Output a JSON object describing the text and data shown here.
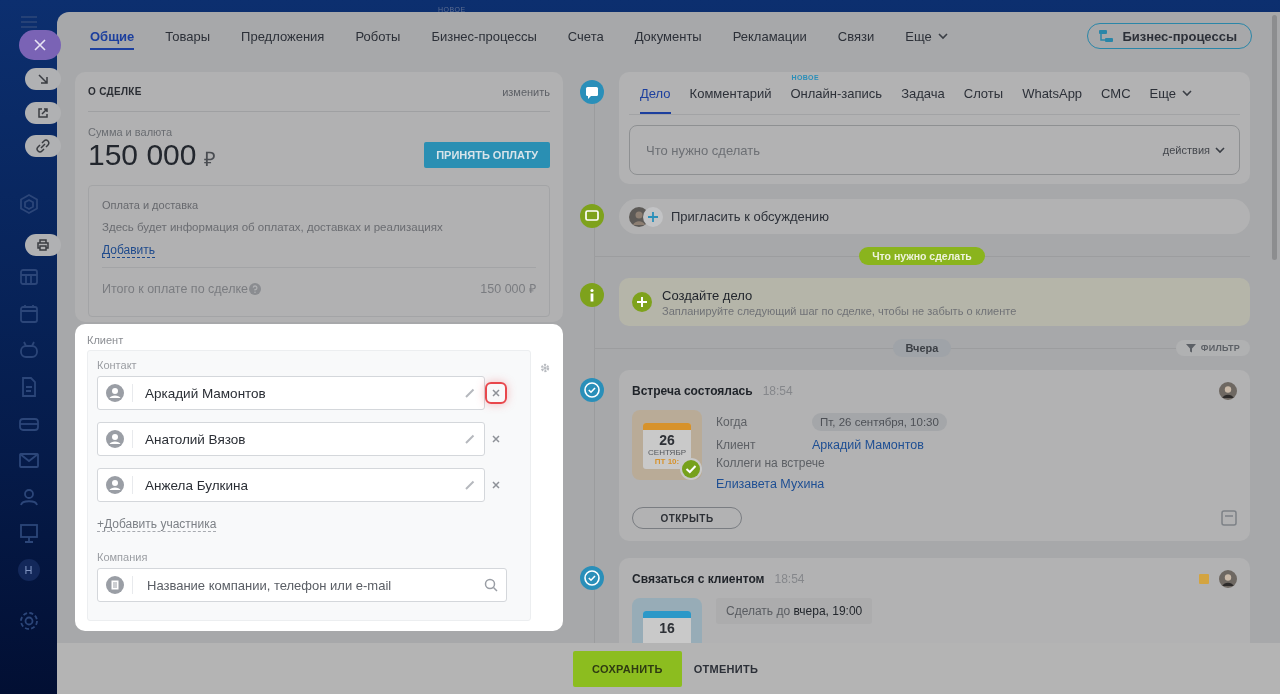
{
  "top_badge": "НОВОЕ",
  "sidebar_avatar": "Н",
  "tabs": [
    {
      "label": "Общие",
      "selected": true
    },
    {
      "label": "Товары",
      "selected": false
    },
    {
      "label": "Предложения",
      "selected": false
    },
    {
      "label": "Роботы",
      "selected": false
    },
    {
      "label": "Бизнес-процессы",
      "selected": false
    },
    {
      "label": "Счета",
      "selected": false
    },
    {
      "label": "Документы",
      "selected": false
    },
    {
      "label": "Рекламации",
      "selected": false
    },
    {
      "label": "Связи",
      "selected": false
    },
    {
      "label": "Еще",
      "selected": false,
      "kind": "more"
    }
  ],
  "bp_button": "Бизнес-процессы",
  "deal": {
    "title": "О СДЕЛКЕ",
    "edit": "изменить",
    "amount_label": "Сумма и валюта",
    "amount": "150 000",
    "currency": "₽",
    "pay_button": "ПРИНЯТЬ ОПЛАТУ",
    "payment": {
      "title": "Оплата и доставка",
      "text": "Здесь будет информация об оплатах, доставках и реализациях",
      "add": "Добавить",
      "total_label": "Итого к оплате по сделке",
      "total": "150 000 ₽"
    }
  },
  "client": {
    "label": "Клиент",
    "contact_label": "Контакт",
    "contacts": [
      {
        "name": "Аркадий Мамонтов",
        "highlighted": true
      },
      {
        "name": "Анатолий Вязов",
        "highlighted": false
      },
      {
        "name": "Анжела Булкина",
        "highlighted": false
      }
    ],
    "add": "+Добавить участника",
    "company_label": "Компания",
    "company_placeholder": "Название компании, телефон или e-mail"
  },
  "activity": {
    "tabs": [
      {
        "label": "Дело",
        "selected": true
      },
      {
        "label": "Комментарий",
        "selected": false
      },
      {
        "label": "Онлайн-запись",
        "selected": false,
        "badge": "НОВОЕ"
      },
      {
        "label": "Задача",
        "selected": false
      },
      {
        "label": "Слоты",
        "selected": false
      },
      {
        "label": "WhatsApp",
        "selected": false
      },
      {
        "label": "СМС",
        "selected": false
      },
      {
        "label": "Еще",
        "selected": false,
        "kind": "more"
      }
    ],
    "placeholder": "Что нужно сделать",
    "actions": "действия"
  },
  "invite": "Пригласить к обсуждению",
  "todo_divider": "Что нужно сделать",
  "create": {
    "title": "Создайте дело",
    "text": "Запланируйте следующий шаг по сделке, чтобы не забыть о клиенте"
  },
  "day_divider": "Вчера",
  "filter": "ФИЛЬТР",
  "events": [
    {
      "kind": "meeting",
      "title": "Встреча состоялась",
      "time": "18:54",
      "calendar": {
        "day": "26",
        "month": "СЕНТЯБР",
        "weekday": "ПТ 10:",
        "color": "#d7922a"
      },
      "fields": [
        {
          "label": "Когда",
          "value": "Пт, 26 сентября, 10:30",
          "kind": "pill"
        },
        {
          "label": "Клиент",
          "value": "Аркадий Мамонтов",
          "kind": "link"
        },
        {
          "label": "Коллеги на встрече",
          "value": "Елизавета Мухина",
          "kind": "link_below"
        }
      ],
      "open": "ОТКРЫТЬ"
    },
    {
      "kind": "call",
      "title": "Связаться с клиентом",
      "time": "18:54",
      "color": "#d3a441",
      "calendar": {
        "day": "16",
        "color": "#2b98c8"
      },
      "deadline": "Сделать до **вчера, 19:00**"
    }
  ],
  "footer": {
    "save": "СОХРАНИТЬ",
    "cancel": "ОТМЕНИТЬ"
  }
}
